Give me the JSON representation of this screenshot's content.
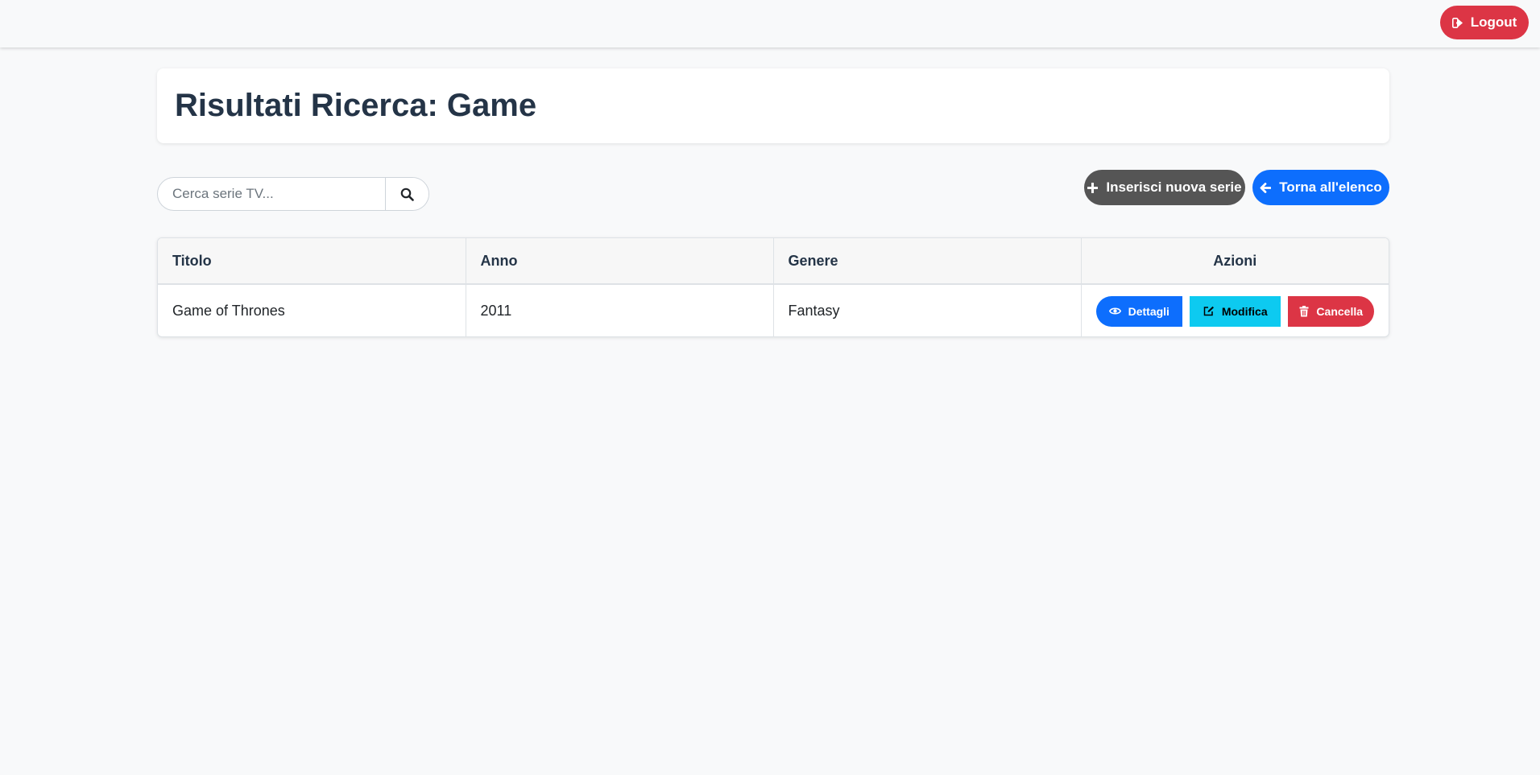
{
  "navbar": {
    "logout_label": "Logout"
  },
  "header": {
    "title": "Risultati Ricerca: Game"
  },
  "search": {
    "placeholder": "Cerca serie TV..."
  },
  "toolbar": {
    "new_label": "Inserisci nuova serie",
    "back_label": "Torna all'elenco"
  },
  "table": {
    "columns": [
      "Titolo",
      "Anno",
      "Genere",
      "Azioni"
    ],
    "rows": [
      {
        "titolo": "Game of Thrones",
        "anno": "2011",
        "genere": "Fantasy",
        "actions": {
          "details": "Dettagli",
          "edit": "Modifica",
          "delete": "Cancella"
        }
      }
    ]
  },
  "colors": {
    "danger": "#dc3545",
    "primary": "#0d6efd",
    "info": "#0dcaf0",
    "secondary": "#555555",
    "title": "#243447"
  },
  "icons": [
    "sign-out-icon",
    "search-icon",
    "plus-icon",
    "arrow-left-icon",
    "eye-icon",
    "edit-icon",
    "trash-icon"
  ]
}
